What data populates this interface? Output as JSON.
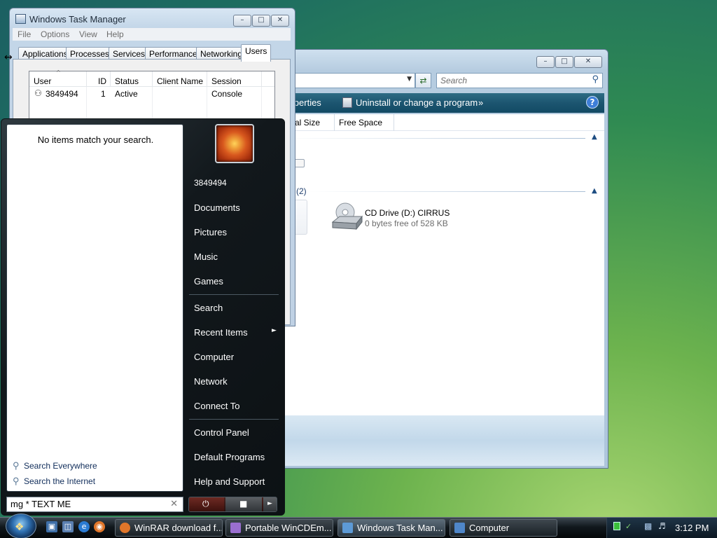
{
  "explorer": {
    "search_placeholder": "Search",
    "cmd_properties": "properties",
    "cmd_uninstall": "Uninstall or change a program",
    "cmd_more": "»",
    "col_total_size": "al Size",
    "col_free_space": "Free Space",
    "group_count": "(2)",
    "cd_drive_name": "CD Drive (D:) CIRRUS",
    "cd_drive_free": "0 bytes free of 528 KB"
  },
  "taskmgr": {
    "title": "Windows Task Manager",
    "menu": [
      "File",
      "Options",
      "View",
      "Help"
    ],
    "tabs": [
      "Applications",
      "Processes",
      "Services",
      "Performance",
      "Networking",
      "Users"
    ],
    "selected_tab": "Users",
    "columns": [
      "User",
      "ID",
      "Status",
      "Client Name",
      "Session"
    ],
    "rows": [
      {
        "user": "3849494",
        "id": "1",
        "status": "Active",
        "client": "",
        "session": "Console"
      }
    ]
  },
  "startmenu": {
    "no_items": "No items match your search.",
    "search_everywhere": "Search Everywhere",
    "search_internet": "Search the Internet",
    "search_value": "mg * TEXT ME",
    "right_items": [
      "3849494",
      "Documents",
      "Pictures",
      "Music",
      "Games",
      "Search",
      "Recent Items",
      "Computer",
      "Network",
      "Connect To",
      "Control Panel",
      "Default Programs",
      "Help and Support"
    ]
  },
  "taskbar": {
    "buttons": [
      {
        "label": "WinRAR download f...",
        "icon": "firefox-icon",
        "color": "#e0762a"
      },
      {
        "label": "Portable WinCDEm...",
        "icon": "wincdemu-icon",
        "color": "#9a6fd0"
      },
      {
        "label": "Windows Task Man...",
        "icon": "taskmgr-icon",
        "color": "#5d9ad6"
      },
      {
        "label": "Computer",
        "icon": "computer-icon",
        "color": "#4f86c9"
      }
    ],
    "clock": "3:12 PM"
  }
}
